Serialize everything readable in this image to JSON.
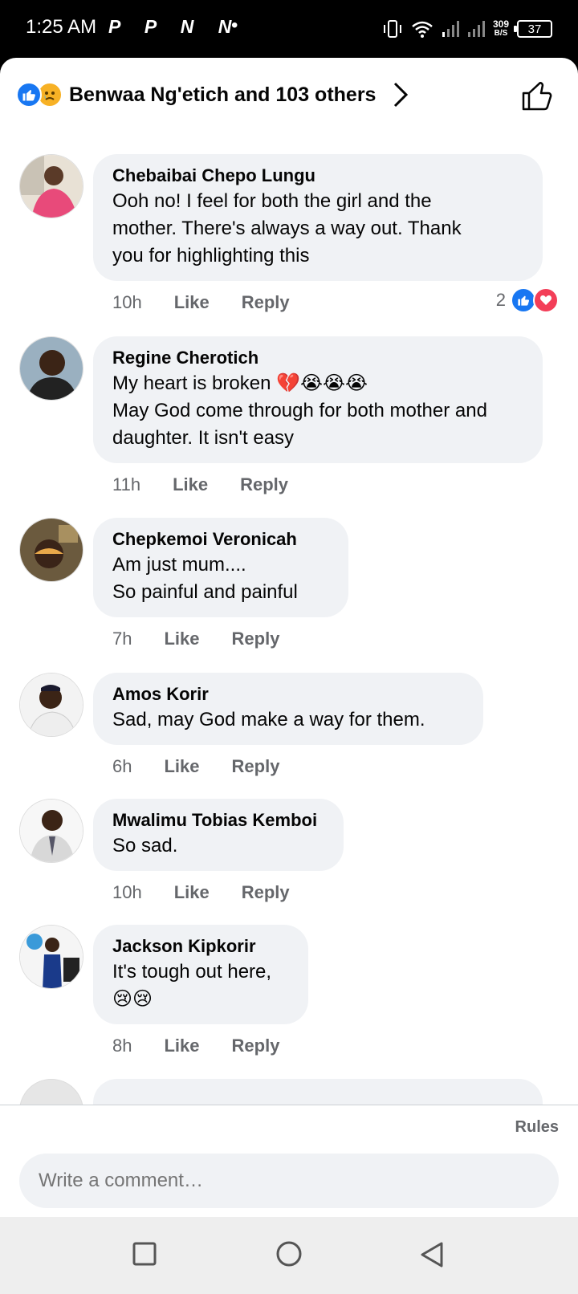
{
  "status_bar": {
    "time": "1:25 AM",
    "apps": "P P N N",
    "dot": "•",
    "net_speed_value": "309",
    "net_speed_unit": "B/S",
    "battery": "37"
  },
  "reactions_header": {
    "text": "Benwaa Ng'etich and 103 others"
  },
  "comments": [
    {
      "author": "Chebaibai Chepo Lungu",
      "text": "Ooh no! I feel for both the girl and the\nmother. There's always a way out. Thank\nyou for highlighting this",
      "time": "10h",
      "like": "Like",
      "reply": "Reply",
      "reaction_count": "2"
    },
    {
      "author": "Regine Cherotich",
      "text": "My heart is broken 💔😭😭😭\nMay God come through for both mother and\ndaughter. It isn't easy",
      "time": "11h",
      "like": "Like",
      "reply": "Reply"
    },
    {
      "author": "Chepkemoi Veronicah",
      "text": "Am just mum....\nSo painful and painful",
      "time": "7h",
      "like": "Like",
      "reply": "Reply"
    },
    {
      "author": "Amos Korir",
      "text": "Sad, may God make a way for them.",
      "time": "6h",
      "like": "Like",
      "reply": "Reply"
    },
    {
      "author": "Mwalimu Tobias Kemboi",
      "text": "So sad.",
      "time": "10h",
      "like": "Like",
      "reply": "Reply"
    },
    {
      "author": "Jackson Kipkorir",
      "text": "It's tough out here,\n😢😢",
      "time": "8h",
      "like": "Like",
      "reply": "Reply"
    }
  ],
  "composer": {
    "rules": "Rules",
    "placeholder": "Write a comment…"
  },
  "colors": {
    "facebook_blue": "#1877f2",
    "love_red": "#f33e58",
    "bubble_bg": "#f0f2f5",
    "secondary_text": "#65676b"
  }
}
